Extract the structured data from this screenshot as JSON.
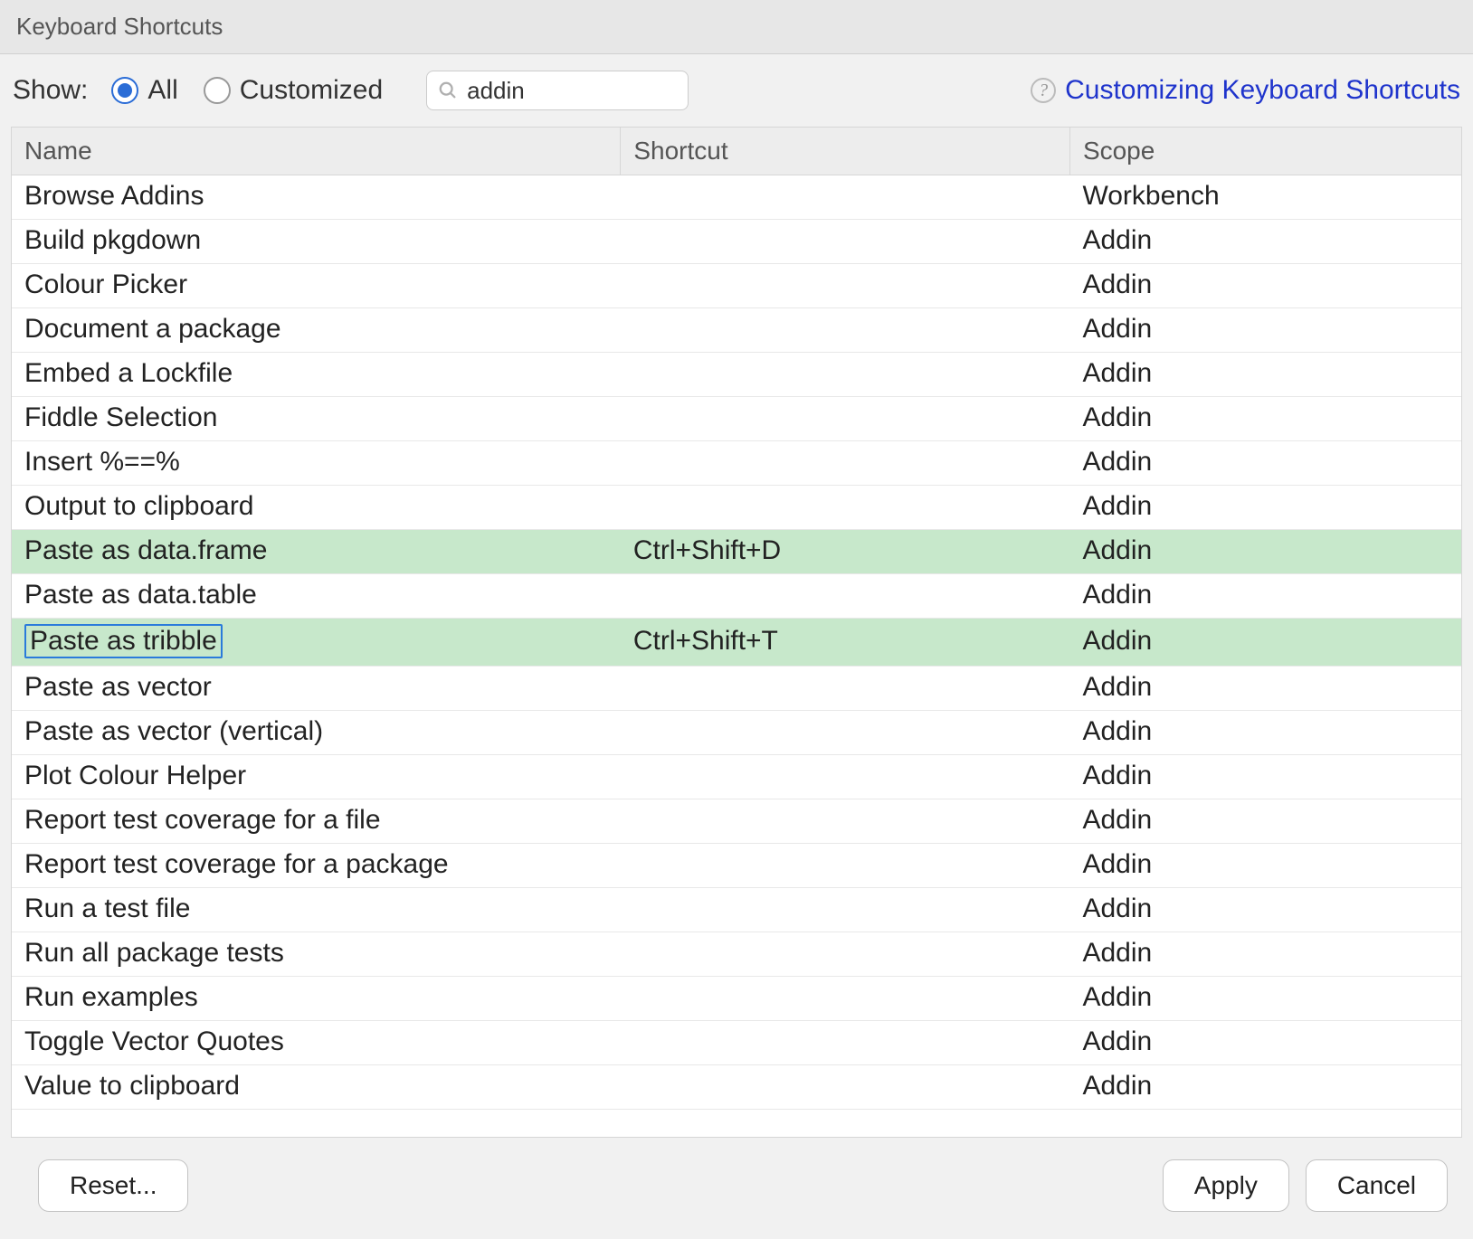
{
  "title": "Keyboard Shortcuts",
  "toolbar": {
    "show_label": "Show:",
    "radio_all": "All",
    "radio_customized": "Customized",
    "search_value": "addin",
    "help_link": "Customizing Keyboard Shortcuts"
  },
  "columns": {
    "name": "Name",
    "shortcut": "Shortcut",
    "scope": "Scope"
  },
  "rows": [
    {
      "name": "Browse Addins",
      "shortcut": "",
      "scope": "Workbench",
      "hl": false,
      "editing": false
    },
    {
      "name": "Build pkgdown",
      "shortcut": "",
      "scope": "Addin",
      "hl": false,
      "editing": false
    },
    {
      "name": "Colour Picker",
      "shortcut": "",
      "scope": "Addin",
      "hl": false,
      "editing": false
    },
    {
      "name": "Document a package",
      "shortcut": "",
      "scope": "Addin",
      "hl": false,
      "editing": false
    },
    {
      "name": "Embed a Lockfile",
      "shortcut": "",
      "scope": "Addin",
      "hl": false,
      "editing": false
    },
    {
      "name": "Fiddle Selection",
      "shortcut": "",
      "scope": "Addin",
      "hl": false,
      "editing": false
    },
    {
      "name": "Insert %==%",
      "shortcut": "",
      "scope": "Addin",
      "hl": false,
      "editing": false
    },
    {
      "name": "Output to clipboard",
      "shortcut": "",
      "scope": "Addin",
      "hl": false,
      "editing": false
    },
    {
      "name": "Paste as data.frame",
      "shortcut": "Ctrl+Shift+D",
      "scope": "Addin",
      "hl": true,
      "editing": false
    },
    {
      "name": "Paste as data.table",
      "shortcut": "",
      "scope": "Addin",
      "hl": false,
      "editing": false
    },
    {
      "name": "Paste as tribble",
      "shortcut": "Ctrl+Shift+T",
      "scope": "Addin",
      "hl": true,
      "editing": true
    },
    {
      "name": "Paste as vector",
      "shortcut": "",
      "scope": "Addin",
      "hl": false,
      "editing": false
    },
    {
      "name": "Paste as vector (vertical)",
      "shortcut": "",
      "scope": "Addin",
      "hl": false,
      "editing": false
    },
    {
      "name": "Plot Colour Helper",
      "shortcut": "",
      "scope": "Addin",
      "hl": false,
      "editing": false
    },
    {
      "name": "Report test coverage for a file",
      "shortcut": "",
      "scope": "Addin",
      "hl": false,
      "editing": false
    },
    {
      "name": "Report test coverage for a package",
      "shortcut": "",
      "scope": "Addin",
      "hl": false,
      "editing": false
    },
    {
      "name": "Run a test file",
      "shortcut": "",
      "scope": "Addin",
      "hl": false,
      "editing": false
    },
    {
      "name": "Run all package tests",
      "shortcut": "",
      "scope": "Addin",
      "hl": false,
      "editing": false
    },
    {
      "name": "Run examples",
      "shortcut": "",
      "scope": "Addin",
      "hl": false,
      "editing": false
    },
    {
      "name": "Toggle Vector Quotes",
      "shortcut": "",
      "scope": "Addin",
      "hl": false,
      "editing": false
    },
    {
      "name": "Value to clipboard",
      "shortcut": "",
      "scope": "Addin",
      "hl": false,
      "editing": false
    }
  ],
  "buttons": {
    "reset": "Reset...",
    "apply": "Apply",
    "cancel": "Cancel"
  }
}
